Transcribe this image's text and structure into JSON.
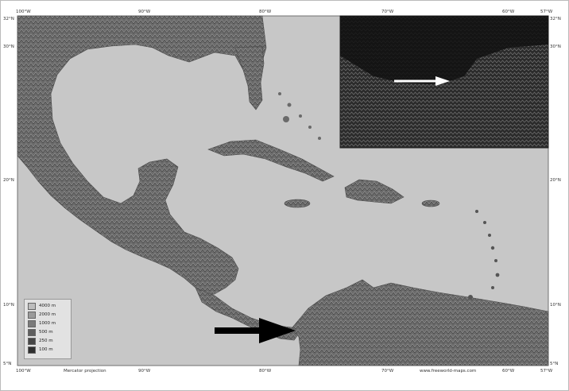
{
  "map": {
    "lat_left": [
      "32°N",
      "30°N",
      "20°N",
      "10°N",
      "5°N"
    ],
    "lat_right": [
      "32°N",
      "30°N",
      "20°N",
      "10°N",
      "5°N"
    ],
    "lon_top": [
      "100°W",
      "90°W",
      "80°W",
      "70°W",
      "60°W",
      "57°W"
    ],
    "lon_bottom": [
      "100°W",
      "90°W",
      "80°W",
      "70°W",
      "60°W",
      "57°W"
    ],
    "projection": "Mercator projection",
    "credit": "www.freeworld-maps.com",
    "legend": [
      {
        "label": "4000 m",
        "color": "#bdbdbd"
      },
      {
        "label": "2000 m",
        "color": "#9a9a9a"
      },
      {
        "label": "1000 m",
        "color": "#7b7b7b"
      },
      {
        "label": "500 m",
        "color": "#5e5e5e"
      },
      {
        "label": "250 m",
        "color": "#464646"
      },
      {
        "label": "100 m",
        "color": "#2f2f2f"
      }
    ],
    "colors": {
      "sea": "#c7c7c7",
      "land": "#6e6e6e",
      "inset": "#2a2a2a",
      "arrow_main": "#000000",
      "arrow_inset": "#ffffff"
    }
  }
}
